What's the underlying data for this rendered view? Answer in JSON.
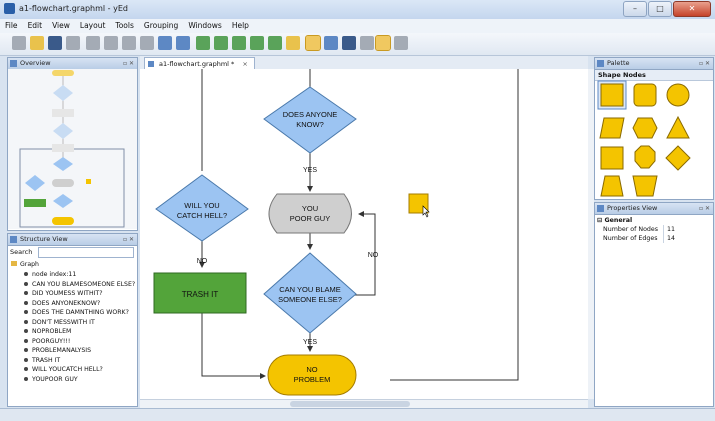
{
  "window": {
    "title": "a1-flowchart.graphml - yEd",
    "min_label": "–",
    "max_label": "□",
    "close_label": "✕"
  },
  "menu": [
    "File",
    "Edit",
    "View",
    "Layout",
    "Tools",
    "Grouping",
    "Windows",
    "Help"
  ],
  "toolbar": {
    "icons": [
      "new-icon",
      "open-icon",
      "save-icon",
      "save-as-icon",
      "cut-icon",
      "copy-icon",
      "paste-icon",
      "delete-icon",
      "undo-icon",
      "redo-icon",
      "zoom-in-icon",
      "zoom-out-icon",
      "zoom-fit-icon",
      "zoom-area-icon",
      "zoom-100-icon",
      "fit-content-icon",
      "edit-mode-icon",
      "navigate-mode-icon",
      "grid-icon",
      "snap-icon",
      "orthogonal-edges-icon",
      "group-icon"
    ]
  },
  "overview": {
    "title": "Overview"
  },
  "structure": {
    "title": "Structure View",
    "search_label": "Search",
    "root": "Graph",
    "items": [
      "node index:11",
      "CAN YOU BLAMESOMEONE ELSE?",
      "DID YOUMESS WITHIT?",
      "DOES ANYONEKNOW?",
      "DOES THE DAMNTHING WORK?",
      "DON'T MESSWITH IT",
      "NOPROBLEM",
      "POORGUY!!!",
      "PROBLEMANALYSIS",
      "TRASH IT",
      "WILL YOUCATCH HELL?",
      "YOUPOOR GUY"
    ]
  },
  "tab": {
    "label": "a1-flowchart.graphml *",
    "close": "×"
  },
  "flow": {
    "does_anyone_1": "DOES ANYONE",
    "does_anyone_2": "KNOW?",
    "yes_1": "YES",
    "will_you_1": "WILL YOU",
    "will_you_2": "CATCH HELL?",
    "poor_guy_1": "YOU",
    "poor_guy_2": "POOR GUY",
    "no_1": "NO",
    "no_2": "NO",
    "trash": "TRASH IT",
    "blame_1": "CAN YOU BLAME",
    "blame_2": "SOMEONE ELSE?",
    "yes_2": "YES",
    "no_problem_1": "NO",
    "no_problem_2": "PROBLEM"
  },
  "colors": {
    "diamond": "#9cc4f2",
    "poor_guy": "#cfcfcf",
    "trash": "#53a43a",
    "no_problem": "#f4c400",
    "accent": "#f5b90a"
  },
  "palette": {
    "title": "Palette",
    "section": "Shape Nodes"
  },
  "properties": {
    "title": "Properties View",
    "section": "General",
    "rows": [
      {
        "name": "Number of Nodes",
        "value": "11"
      },
      {
        "name": "Number of Edges",
        "value": "14"
      }
    ]
  }
}
